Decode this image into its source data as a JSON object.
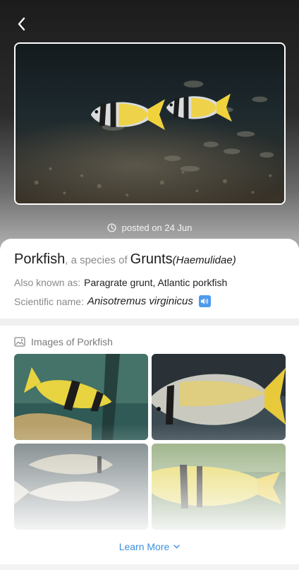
{
  "header": {
    "back_icon": "chevron-left-icon"
  },
  "photo": {
    "posted_icon": "clock-icon",
    "posted_text": "posted on 24 Jun"
  },
  "species": {
    "name": "Porkfish",
    "species_of_text": ", a species of",
    "family": "Grunts",
    "family_latin": "(Haemulidae)",
    "aka_label": "Also known as:",
    "aka_value": "Paragrate grunt, Atlantic porkfish",
    "sci_label": "Scientific name:",
    "sci_value": "Anisotremus virginicus",
    "speaker_icon": "speaker-icon"
  },
  "images": {
    "header_icon": "image-icon",
    "header_text": "Images of Porkfish",
    "tiles": [
      "porkfish-photo-1",
      "porkfish-photo-2",
      "porkfish-photo-3",
      "porkfish-photo-4"
    ]
  },
  "footer": {
    "learn_more": "Learn More",
    "learn_more_icon": "chevron-down-icon"
  },
  "colors": {
    "accent": "#3d8fe0",
    "speaker": "#4c9bee",
    "fish_yellow": "#f0d23a",
    "fish_silver": "#d9dde0"
  }
}
